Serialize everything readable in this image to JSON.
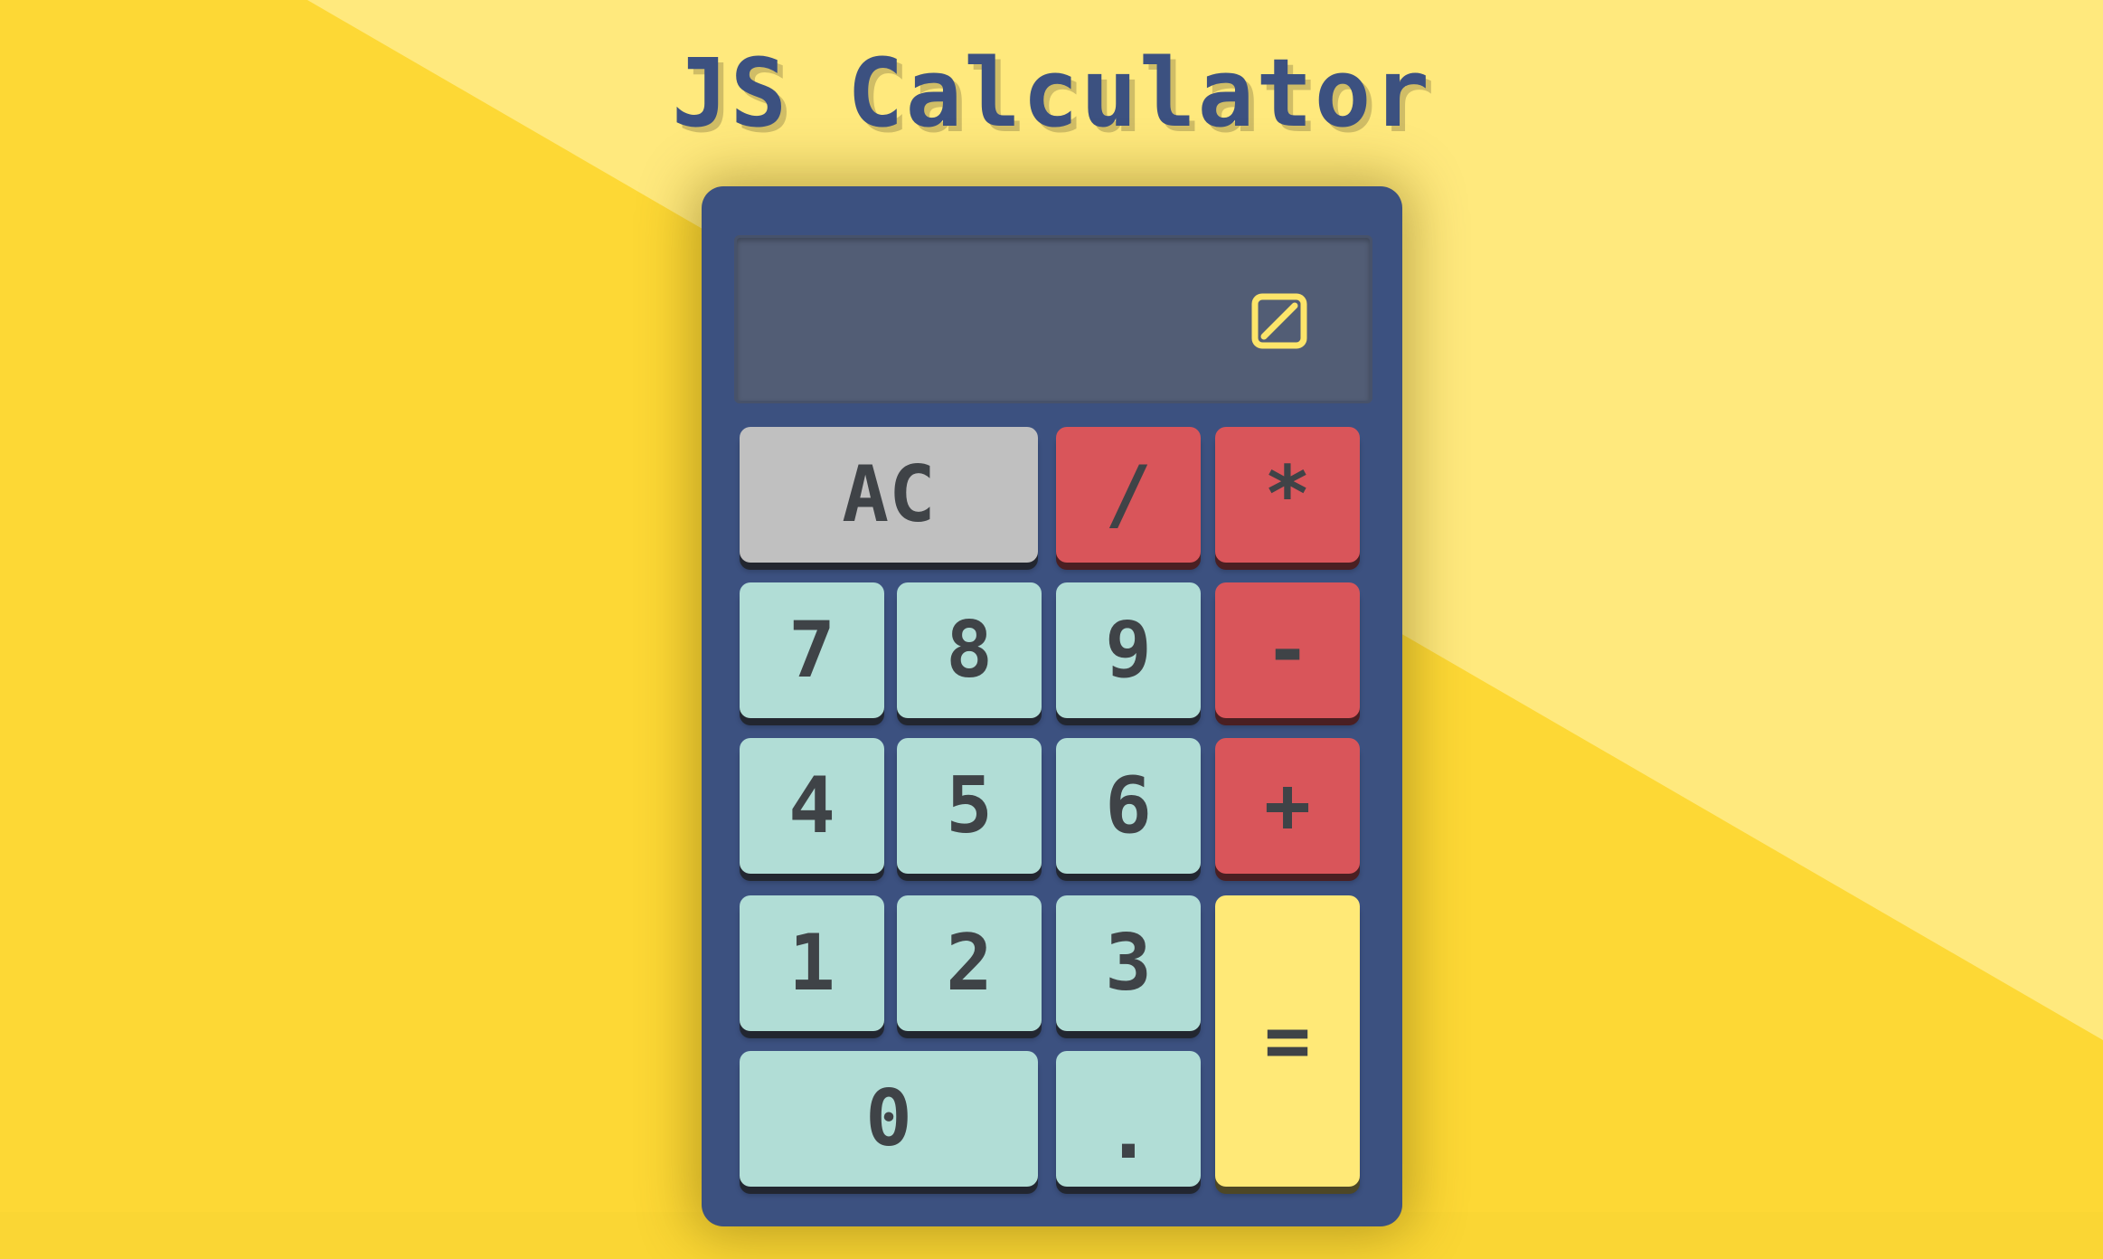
{
  "page": {
    "title": "JS Calculator"
  },
  "colors": {
    "background": "#fdd835",
    "background_light": "#ffe97d",
    "calculator_body": "#3c5180",
    "display": "#525d75",
    "number_key": "#b1ddd6",
    "operator_key": "#d9555a",
    "clear_key": "#c0c0c0",
    "equals_key": "#ffe977",
    "key_text": "#3f4347",
    "icon": "#fde56a"
  },
  "display": {
    "value": "",
    "icon": "theme-toggle-icon"
  },
  "keys": {
    "clear": "AC",
    "divide": "/",
    "multiply": "*",
    "seven": "7",
    "eight": "8",
    "nine": "9",
    "subtract": "-",
    "four": "4",
    "five": "5",
    "six": "6",
    "add": "+",
    "one": "1",
    "two": "2",
    "three": "3",
    "equals": "=",
    "zero": "0",
    "decimal": "."
  }
}
